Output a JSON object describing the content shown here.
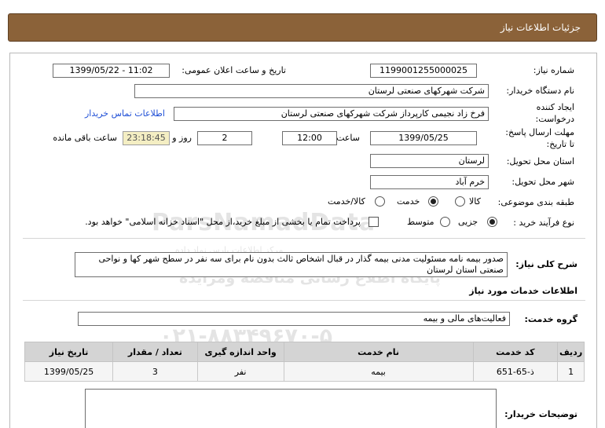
{
  "header": {
    "title": "جزئیات اطلاعات نیاز"
  },
  "form": {
    "need_number_label": "شماره نیاز:",
    "need_number": "1199001255000025",
    "announce_label": "تاریخ و ساعت اعلان عمومی:",
    "announce_value": "1399/05/22 - 11:02",
    "buyer_org_label": "نام دستگاه خریدار:",
    "buyer_org": "شرکت شهرکهای صنعتی لرستان",
    "creator_label_1": "ایجاد کننده",
    "creator_label_2": "درخواست:",
    "creator": "فرخ زاد نجیمی کارپرداز شرکت شهرکهای صنعتی لرستان",
    "contact_link": "اطلاعات تماس خریدار",
    "deadline_label_1": "مهلت ارسال پاسخ:",
    "deadline_label_2": "تا تاریخ:",
    "deadline_date": "1399/05/25",
    "time_label": "ساعت",
    "deadline_time": "12:00",
    "days_value": "2",
    "days_label": "روز و",
    "remaining_time": "23:18:45",
    "remaining_label": "ساعت باقی مانده",
    "province_label": "استان محل تحویل:",
    "province": "لرستان",
    "city_label": "شهر محل تحویل:",
    "city": "خرم آباد",
    "category_label": "طبقه بندی موضوعی:",
    "category_options": {
      "goods": "کالا",
      "service": "خدمت",
      "goods_service": "کالا/خدمت"
    },
    "category_selected": "خدمت",
    "process_label": "نوع فرآیند خرید :",
    "process_options": {
      "partial": "جزیی",
      "medium": "متوسط"
    },
    "process_selected": "جزیی",
    "payment_note": "پرداخت تمام یا بخشی از مبلغ خرید،از محل \"اسناد خزانه اسلامی\" خواهد بود.",
    "description_label": "شرح کلی نیاز:",
    "description": "صدور بیمه نامه مسئولیت مدنی بیمه گذار در قبال اشخاص ثالث بدون نام برای سه نفر در سطح شهر کها و نواحی صنعتی استان لرستان",
    "services_info_title": "اطلاعات خدمات مورد نیاز",
    "service_group_label": "گروه خدمت:",
    "service_group": "فعالیت‌های مالی و بیمه",
    "buyer_notes_label": "توضیحات خریدار:"
  },
  "table": {
    "headers": [
      "ردیف",
      "کد خدمت",
      "نام خدمت",
      "واحد اندازه گیری",
      "تعداد / مقدار",
      "تاریخ نیاز"
    ],
    "rows": [
      [
        "1",
        "ذ-65-651",
        "بیمه",
        "نفر",
        "3",
        "1399/05/25"
      ]
    ]
  },
  "watermark": {
    "en": "ParsNamadData",
    "small": "مرکز اطلاعات پارس نماد داده",
    "fa1": "پایگاه اطلاع رسانی مناقصه ومزایده",
    "phone": "۰۲۱-۸۸۳۴۹۶۷۰-۵"
  },
  "colors": {
    "header_bg": "#8b6239",
    "link": "#1f4fd6",
    "timer_bg": "#f4eec3",
    "table_header_bg": "#d4d4d4"
  }
}
